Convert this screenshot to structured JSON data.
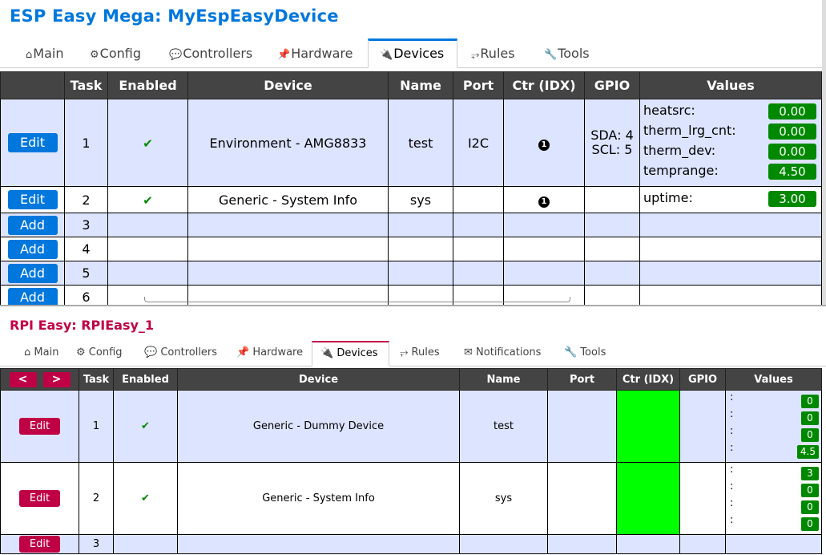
{
  "esp": {
    "title": "ESP Easy Mega: MyEspEasyDevice",
    "tabs": [
      {
        "icon": "⌂",
        "label": "Main"
      },
      {
        "icon": "⚙",
        "label": "Config"
      },
      {
        "icon": "💬",
        "label": "Controllers"
      },
      {
        "icon": "📌",
        "label": "Hardware"
      },
      {
        "icon": "🔌",
        "label": "Devices"
      },
      {
        "icon": "⥅",
        "label": "Rules"
      },
      {
        "icon": "🔧",
        "label": "Tools"
      }
    ],
    "active_tab": "Devices",
    "headers": [
      "",
      "Task",
      "Enabled",
      "Device",
      "Name",
      "Port",
      "Ctr (IDX)",
      "GPIO",
      "Values"
    ],
    "rows": [
      {
        "button": "Edit",
        "task": "1",
        "enabled": "✔",
        "device": "Environment - AMG8833",
        "name": "test",
        "port": "I2C",
        "ctr": "1",
        "gpio": [
          "SDA: 4",
          "SCL: 5"
        ],
        "values": [
          {
            "name": "heatsrc:",
            "value": "0.00"
          },
          {
            "name": "therm_lrg_cnt:",
            "value": "0.00"
          },
          {
            "name": "therm_dev:",
            "value": "0.00"
          },
          {
            "name": "temprange:",
            "value": "4.50"
          }
        ]
      },
      {
        "button": "Edit",
        "task": "2",
        "enabled": "✔",
        "device": "Generic - System Info",
        "name": "sys",
        "port": "",
        "ctr": "1",
        "gpio": [],
        "values": [
          {
            "name": "uptime:",
            "value": "3.00"
          }
        ]
      },
      {
        "button": "Add",
        "task": "3"
      },
      {
        "button": "Add",
        "task": "4"
      },
      {
        "button": "Add",
        "task": "5"
      },
      {
        "button": "Add",
        "task": "6"
      }
    ]
  },
  "rpi": {
    "title": "RPI Easy: RPIEasy_1",
    "tabs": [
      {
        "icon": "⌂",
        "label": "Main"
      },
      {
        "icon": "⚙",
        "label": "Config"
      },
      {
        "icon": "💬",
        "label": "Controllers"
      },
      {
        "icon": "📌",
        "label": "Hardware"
      },
      {
        "icon": "🔌",
        "label": "Devices"
      },
      {
        "icon": "⥅",
        "label": "Rules"
      },
      {
        "icon": "✉",
        "label": "Notifications"
      },
      {
        "icon": "🔧",
        "label": "Tools"
      }
    ],
    "active_tab": "Devices",
    "nav": {
      "prev": "<",
      "next": ">"
    },
    "headers": [
      "",
      "Task",
      "Enabled",
      "Device",
      "Name",
      "Port",
      "Ctr (IDX)",
      "GPIO",
      "Values"
    ],
    "rows": [
      {
        "button": "Edit",
        "task": "1",
        "enabled": "✔",
        "device": "Generic - Dummy Device",
        "name": "test",
        "values": [
          {
            "name": ":",
            "value": "0"
          },
          {
            "name": ":",
            "value": "0"
          },
          {
            "name": ":",
            "value": "0"
          },
          {
            "name": ":",
            "value": "4.5"
          }
        ]
      },
      {
        "button": "Edit",
        "task": "2",
        "enabled": "✔",
        "device": "Generic - System Info",
        "name": "sys",
        "values": [
          {
            "name": ":",
            "value": "3"
          },
          {
            "name": ":",
            "value": "0"
          },
          {
            "name": ":",
            "value": "0"
          },
          {
            "name": ":",
            "value": "0"
          }
        ]
      },
      {
        "button": "Edit",
        "task": "3"
      }
    ]
  },
  "colors": {
    "esp_accent": "#0077DD",
    "rpi_accent": "#C00045",
    "header_bg": "#444444",
    "odd_row": "#DDE4FF",
    "value_badge": "#008800",
    "ctr_green": "#00FF00"
  }
}
